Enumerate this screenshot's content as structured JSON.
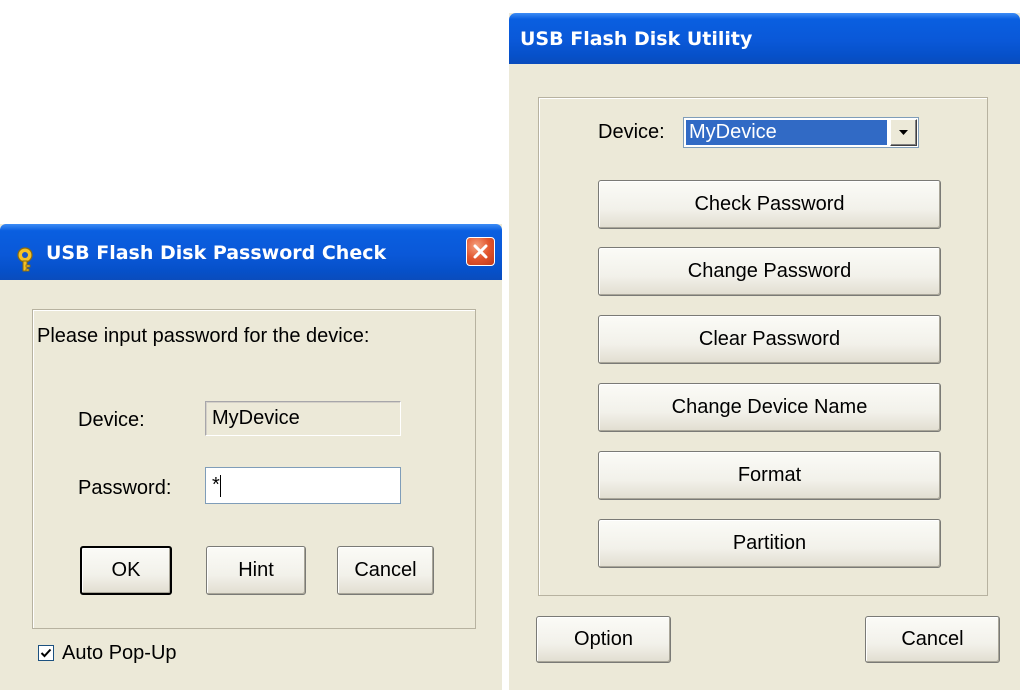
{
  "password_check": {
    "title": "USB Flash Disk Password Check",
    "prompt": "Please input password for the device:",
    "device_label": "Device:",
    "device_value": "MyDevice",
    "password_label": "Password:",
    "password_value": "*",
    "ok_label": "OK",
    "hint_label": "Hint",
    "cancel_label": "Cancel",
    "auto_popup_label": "Auto Pop-Up",
    "auto_popup_checked": true,
    "close_icon": "close-icon",
    "app_icon": "usb-key-icon"
  },
  "utility": {
    "title": "USB Flash Disk Utility",
    "device_label": "Device:",
    "device_selected": "MyDevice",
    "buttons": [
      "Check Password",
      "Change Password",
      "Clear Password",
      "Change Device Name",
      "Format",
      "Partition"
    ],
    "option_label": "Option",
    "cancel_label": "Cancel"
  },
  "colors": {
    "titlebar": "#0a58d8",
    "dialog_bg": "#ece9d8",
    "selection": "#316ac5",
    "close_button": "#e2552d"
  }
}
